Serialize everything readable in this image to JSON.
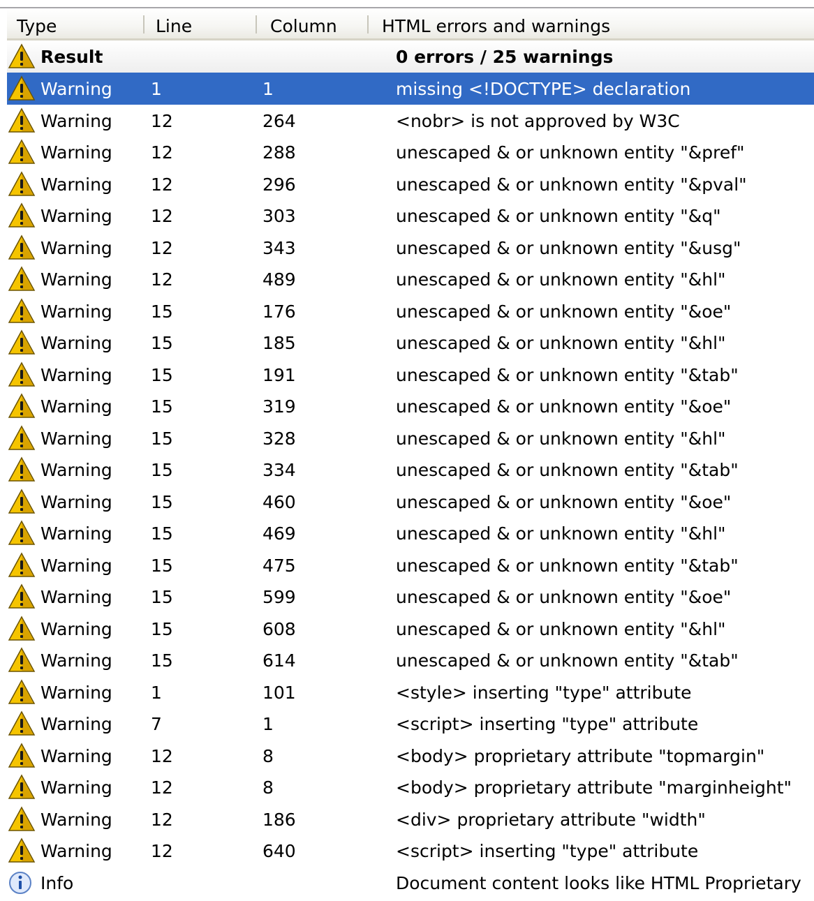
{
  "columns": {
    "type": "Type",
    "line": "Line",
    "column": "Column",
    "message": "HTML errors and warnings"
  },
  "result": {
    "type": "Result",
    "message": "0 errors / 25 warnings",
    "icon": "warning-icon"
  },
  "rows": [
    {
      "type": "Warning",
      "line": "1",
      "column": "1",
      "message": "missing <!DOCTYPE> declaration",
      "icon": "warning-icon",
      "selected": true
    },
    {
      "type": "Warning",
      "line": "12",
      "column": "264",
      "message": "<nobr> is not approved by W3C",
      "icon": "warning-icon"
    },
    {
      "type": "Warning",
      "line": "12",
      "column": "288",
      "message": "unescaped & or unknown entity \"&pref\"",
      "icon": "warning-icon"
    },
    {
      "type": "Warning",
      "line": "12",
      "column": "296",
      "message": "unescaped & or unknown entity \"&pval\"",
      "icon": "warning-icon"
    },
    {
      "type": "Warning",
      "line": "12",
      "column": "303",
      "message": "unescaped & or unknown entity \"&q\"",
      "icon": "warning-icon"
    },
    {
      "type": "Warning",
      "line": "12",
      "column": "343",
      "message": "unescaped & or unknown entity \"&usg\"",
      "icon": "warning-icon"
    },
    {
      "type": "Warning",
      "line": "12",
      "column": "489",
      "message": "unescaped & or unknown entity \"&hl\"",
      "icon": "warning-icon"
    },
    {
      "type": "Warning",
      "line": "15",
      "column": "176",
      "message": "unescaped & or unknown entity \"&oe\"",
      "icon": "warning-icon"
    },
    {
      "type": "Warning",
      "line": "15",
      "column": "185",
      "message": "unescaped & or unknown entity \"&hl\"",
      "icon": "warning-icon"
    },
    {
      "type": "Warning",
      "line": "15",
      "column": "191",
      "message": "unescaped & or unknown entity \"&tab\"",
      "icon": "warning-icon"
    },
    {
      "type": "Warning",
      "line": "15",
      "column": "319",
      "message": "unescaped & or unknown entity \"&oe\"",
      "icon": "warning-icon"
    },
    {
      "type": "Warning",
      "line": "15",
      "column": "328",
      "message": "unescaped & or unknown entity \"&hl\"",
      "icon": "warning-icon"
    },
    {
      "type": "Warning",
      "line": "15",
      "column": "334",
      "message": "unescaped & or unknown entity \"&tab\"",
      "icon": "warning-icon"
    },
    {
      "type": "Warning",
      "line": "15",
      "column": "460",
      "message": "unescaped & or unknown entity \"&oe\"",
      "icon": "warning-icon"
    },
    {
      "type": "Warning",
      "line": "15",
      "column": "469",
      "message": "unescaped & or unknown entity \"&hl\"",
      "icon": "warning-icon"
    },
    {
      "type": "Warning",
      "line": "15",
      "column": "475",
      "message": "unescaped & or unknown entity \"&tab\"",
      "icon": "warning-icon"
    },
    {
      "type": "Warning",
      "line": "15",
      "column": "599",
      "message": "unescaped & or unknown entity \"&oe\"",
      "icon": "warning-icon"
    },
    {
      "type": "Warning",
      "line": "15",
      "column": "608",
      "message": "unescaped & or unknown entity \"&hl\"",
      "icon": "warning-icon"
    },
    {
      "type": "Warning",
      "line": "15",
      "column": "614",
      "message": "unescaped & or unknown entity \"&tab\"",
      "icon": "warning-icon"
    },
    {
      "type": "Warning",
      "line": "1",
      "column": "101",
      "message": "<style> inserting \"type\" attribute",
      "icon": "warning-icon"
    },
    {
      "type": "Warning",
      "line": "7",
      "column": "1",
      "message": "<script> inserting \"type\" attribute",
      "icon": "warning-icon"
    },
    {
      "type": "Warning",
      "line": "12",
      "column": "8",
      "message": "<body> proprietary attribute \"topmargin\"",
      "icon": "warning-icon"
    },
    {
      "type": "Warning",
      "line": "12",
      "column": "8",
      "message": "<body> proprietary attribute \"marginheight\"",
      "icon": "warning-icon"
    },
    {
      "type": "Warning",
      "line": "12",
      "column": "186",
      "message": "<div> proprietary attribute \"width\"",
      "icon": "warning-icon"
    },
    {
      "type": "Warning",
      "line": "12",
      "column": "640",
      "message": "<script> inserting \"type\" attribute",
      "icon": "warning-icon"
    },
    {
      "type": "Info",
      "line": "",
      "column": "",
      "message": "Document content looks like HTML Proprietary",
      "icon": "info-icon"
    }
  ],
  "colors": {
    "selection": "#316ac5",
    "warning_fill": "#f5c400",
    "info_fill": "#dfe9fb"
  }
}
